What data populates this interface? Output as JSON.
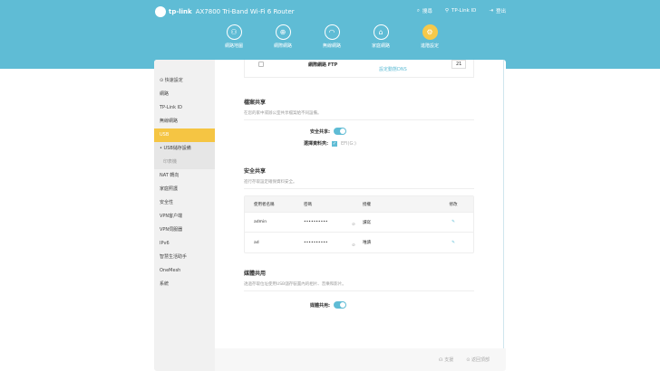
{
  "header": {
    "brand": "tp-link",
    "model": "AX7800 Tri-Band Wi-Fi 6 Router",
    "search": "搜尋",
    "tplink_id": "TP-Link ID",
    "logout": "登出"
  },
  "nav": [
    {
      "label": "網路地圖",
      "icon": "network-map-icon"
    },
    {
      "label": "網際網路",
      "icon": "globe-icon"
    },
    {
      "label": "無線網路",
      "icon": "wifi-icon"
    },
    {
      "label": "家庭網路",
      "icon": "home-icon"
    },
    {
      "label": "進階設定",
      "icon": "gear-icon",
      "active": true
    }
  ],
  "sidebar": [
    "快速設定",
    "網路",
    "TP-Link ID",
    "無線網路",
    "USB",
    "USB儲存設備",
    "印表機",
    "NAT 轉向",
    "家庭照護",
    "安全性",
    "VPN客户端",
    "VPN伺服器",
    "IPv6",
    "智慧生活助手",
    "OneMesh",
    "系統"
  ],
  "ftp": {
    "label": "網際網路 FTP",
    "link": "設定動態DNS",
    "port": "21"
  },
  "file_share": {
    "title": "檔案共享",
    "desc": "在您的家中或辦公室共享檔案給不同設備。",
    "secure_label": "安全共享:",
    "folder_label": "選擇資料夾:",
    "folder_value": "EFI(G:)"
  },
  "secure_share": {
    "title": "安全共享",
    "desc": "進行存取設定確保資料安全。",
    "headers": [
      "使用者名稱",
      "密碼",
      "授權",
      "修改"
    ],
    "rows": [
      {
        "user": "admin",
        "password": "••••••••••",
        "perm": "讀寫"
      },
      {
        "user": "ad",
        "password": "••••••••••",
        "perm": "唯讀"
      }
    ]
  },
  "media": {
    "title": "媒體共用",
    "desc": "透過存取位址使用USB儲存裝置內的相片、音樂和影片。",
    "label": "媒體共用:"
  },
  "footer": {
    "support": "支援",
    "top": "返回頂部"
  },
  "colors": {
    "header": "#5fbcd5",
    "accent": "#f5c543"
  }
}
